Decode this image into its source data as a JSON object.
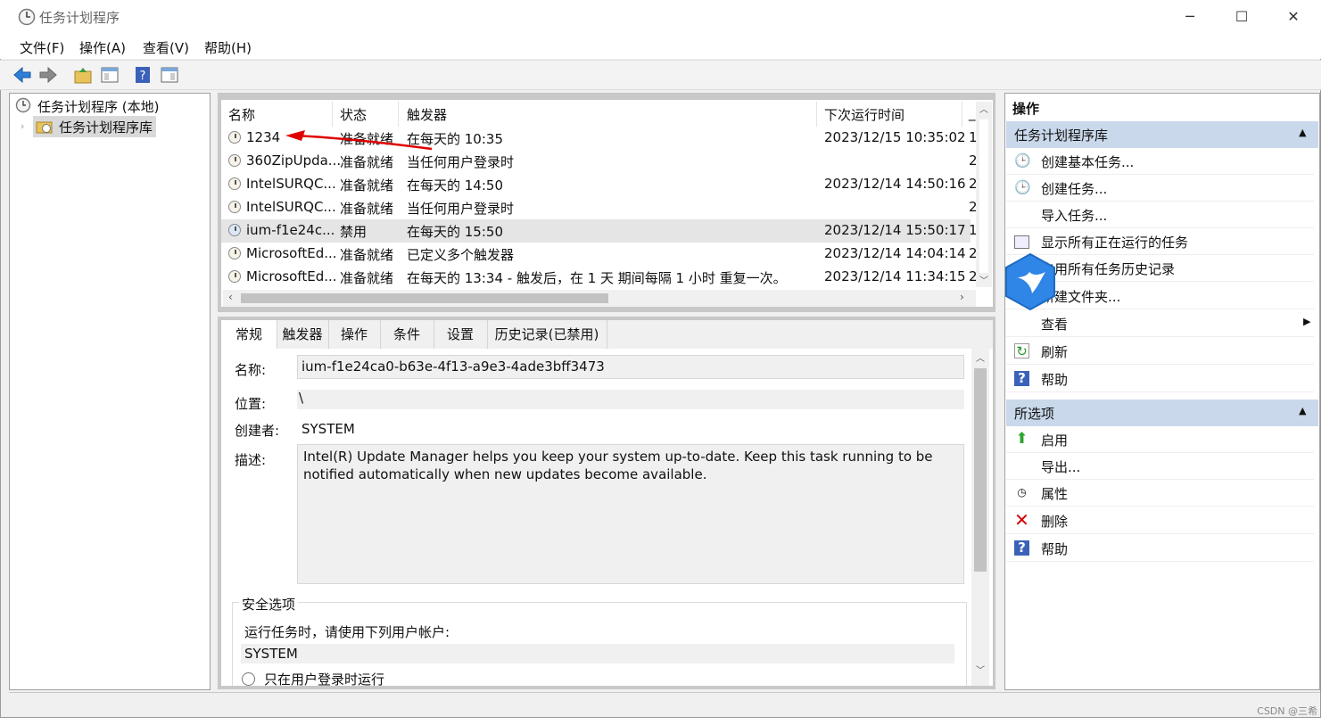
{
  "window": {
    "title": "任务计划程序",
    "controls": {
      "minimize": "─",
      "maximize": "☐",
      "close": "✕"
    }
  },
  "menu": [
    "文件(F)",
    "操作(A)",
    "查看(V)",
    "帮助(H)"
  ],
  "tree": {
    "root": "任务计划程序 (本地)",
    "child": "任务计划程序库"
  },
  "list": {
    "columns": [
      "名称",
      "状态",
      "触发器",
      "下次运行时间",
      "_"
    ],
    "rows": [
      {
        "name": "1234",
        "status": "准备就绪",
        "trigger": "在每天的 10:35",
        "next": "2023/12/15 10:35:02",
        "last": "1"
      },
      {
        "name": "360ZipUpda...",
        "status": "准备就绪",
        "trigger": "当任何用户登录时",
        "next": "",
        "last": "2"
      },
      {
        "name": "IntelSURQC...",
        "status": "准备就绪",
        "trigger": "在每天的 14:50",
        "next": "2023/12/14 14:50:16",
        "last": "2"
      },
      {
        "name": "IntelSURQC...",
        "status": "准备就绪",
        "trigger": "当任何用户登录时",
        "next": "",
        "last": "2"
      },
      {
        "name": "ium-f1e24c...",
        "status": "禁用",
        "trigger": "在每天的 15:50",
        "next": "2023/12/14 15:50:17",
        "last": "1"
      },
      {
        "name": "MicrosoftEd...",
        "status": "准备就绪",
        "trigger": "已定义多个触发器",
        "next": "2023/12/14 14:04:14",
        "last": "2"
      },
      {
        "name": "MicrosoftEd...",
        "status": "准备就绪",
        "trigger": "在每天的 13:34 - 触发后，在 1 天 期间每隔 1 小时 重复一次。",
        "next": "2023/12/14 11:34:15",
        "last": "2"
      }
    ]
  },
  "tabs": [
    "常规",
    "触发器",
    "操作",
    "条件",
    "设置",
    "历史记录(已禁用)"
  ],
  "detail": {
    "name_label": "名称:",
    "name_value": "ium-f1e24ca0-b63e-4f13-a9e3-4ade3bff3473",
    "location_label": "位置:",
    "location_value": "\\",
    "author_label": "创建者:",
    "author_value": "SYSTEM",
    "desc_label": "描述:",
    "desc_value": "Intel(R) Update Manager helps you keep your system up-to-date. Keep this task running to be notified automatically when new updates become available.",
    "security_label": "安全选项",
    "run_as_label": "运行任务时，请使用下列用户帐户:",
    "run_as_value": "SYSTEM",
    "radio_label": "只在用户登录时运行"
  },
  "actions": {
    "header": "操作",
    "section1": {
      "title": "任务计划程序库",
      "items": [
        "创建基本任务...",
        "创建任务...",
        "导入任务...",
        "显示所有正在运行的任务",
        "启用所有任务历史记录",
        "新建文件夹...",
        "查看",
        "刷新",
        "帮助"
      ]
    },
    "section2": {
      "title": "所选项",
      "items": [
        "启用",
        "导出...",
        "属性",
        "删除",
        "帮助"
      ]
    }
  },
  "watermark": "CSDN @三希",
  "colors": {
    "annotation_arrow": "#e00000",
    "section_header": "#c9d8ea"
  }
}
